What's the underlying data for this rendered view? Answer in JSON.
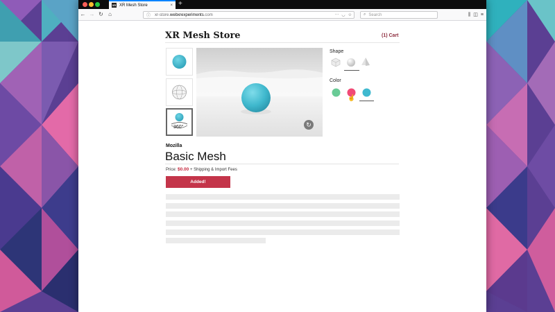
{
  "browser": {
    "tab_favicon": "XR",
    "tab_title": "XR Mesh Store",
    "tab_close": "×",
    "new_tab": "+",
    "url_prefix": "xr-store.",
    "url_host": "webxrexperiments",
    "url_suffix": ".com",
    "search_placeholder": "Search"
  },
  "store": {
    "title": "XR Mesh Store",
    "cart_label": "(1) Cart"
  },
  "viewer": {
    "thumb_360_label": "360°"
  },
  "options": {
    "shape_label": "Shape",
    "color_label": "Color",
    "colors": [
      "#69cb96",
      "#f14a76",
      "#40b9cf"
    ],
    "selected_color": "#40b9cf",
    "selected_shape": "sphere"
  },
  "product": {
    "brand": "Mozilla",
    "name": "Basic Mesh",
    "price_prefix": "Price:",
    "price": "$0.00",
    "price_suffix": "+ Shipping & Import Fees",
    "button_label": "Added!"
  },
  "theme": {
    "accent": "#c4354a",
    "sphere_color": "#40b9cf"
  }
}
